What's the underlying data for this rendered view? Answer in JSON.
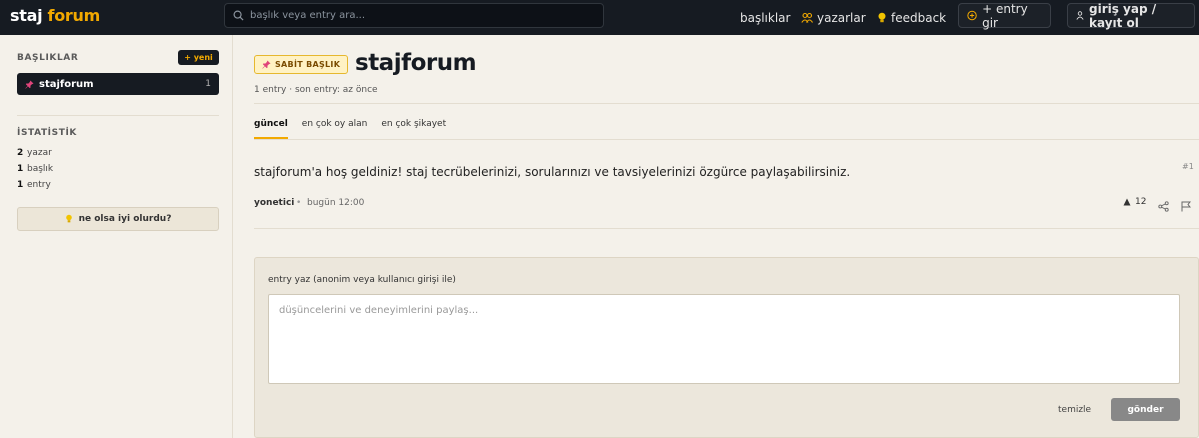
{
  "header": {
    "logo_primary": "staj",
    "logo_accent": "forum",
    "search_placeholder": "başlık veya entry ara...",
    "nav_topics": "başlıklar",
    "nav_authors": "yazarlar",
    "nav_feedback": "feedback",
    "new_entry_label": "+ entry gir",
    "login_label": "giriş yap / kayıt ol"
  },
  "sidebar": {
    "topics_heading": "BAŞLIKLAR",
    "new_button": "+ yeni",
    "topics": [
      {
        "label": "stajforum",
        "count": "1"
      }
    ],
    "stats_heading": "İSTATİSTİK",
    "stats": [
      {
        "value": "2",
        "label": "yazar"
      },
      {
        "value": "1",
        "label": "başlık"
      },
      {
        "value": "1",
        "label": "entry"
      }
    ],
    "idea_button": "ne olsa iyi olurdu?"
  },
  "topic": {
    "badge": "SABİT BAŞLIK",
    "title": "stajforum",
    "meta": "1 entry · son entry: az önce",
    "tabs": [
      {
        "label": "güncel",
        "active": true
      },
      {
        "label": "en çok oy alan",
        "active": false
      },
      {
        "label": "en çok şikayet",
        "active": false
      }
    ]
  },
  "entry": {
    "number": "#1",
    "text": "stajforum'a hoş geldiniz! staj tecrübelerinizi, sorularınızı ve tavsiyelerinizi özgürce paylaşabilirsiniz.",
    "author": "yonetici",
    "separator": "•",
    "date": "bugün 12:00",
    "votes": "12"
  },
  "composer": {
    "label": "entry yaz (anonim veya kullanıcı girişi ile)",
    "placeholder": "düşüncelerini ve deneyimlerini paylaş...",
    "value": "",
    "clear_label": "temizle",
    "send_label": "gönder"
  },
  "colors": {
    "accent": "#f2a900",
    "header_bg": "#161b22",
    "page_bg": "#f4f1ea"
  }
}
